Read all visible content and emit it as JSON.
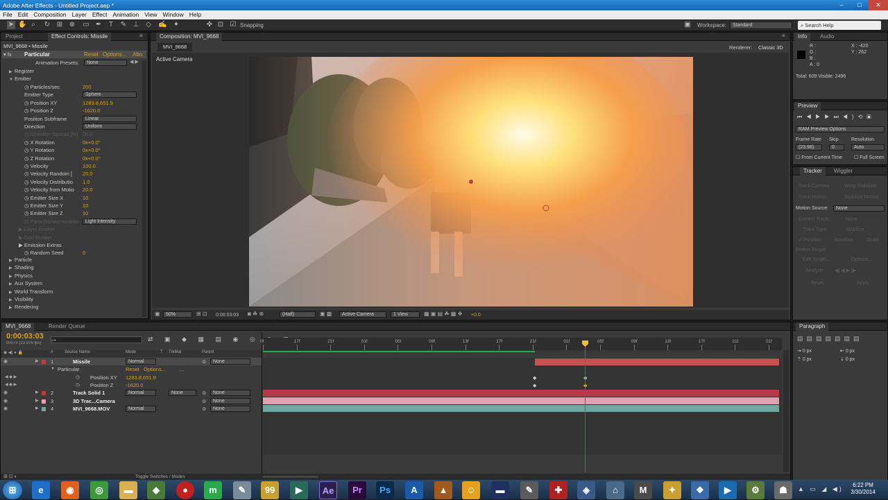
{
  "window": {
    "title": "Adobe After Effects - Untitled Project.aep *",
    "help_placeholder": "Search Help"
  },
  "menu": [
    "File",
    "Edit",
    "Composition",
    "Layer",
    "Effect",
    "Animation",
    "View",
    "Window",
    "Help"
  ],
  "toolbar": {
    "snapping": "Snapping",
    "workspace_label": "Workspace:",
    "workspace": "Standard"
  },
  "effect_panel": {
    "tabs": [
      "Project",
      "Effect Controls: Missile"
    ],
    "header": "MVI_9668 • Missile",
    "effect_name": "Particular",
    "reset": "Reset",
    "options": "Options...",
    "about": "Abo",
    "presets_label": "Animation Presets:",
    "presets_value": "None",
    "groups": [
      "Register",
      "Emitter"
    ],
    "emitter_props": [
      {
        "label": "Particles/sec",
        "value": "200"
      },
      {
        "label": "Emitter Type",
        "value": "Sphere"
      },
      {
        "label": "Position XY",
        "value": "1283.8,651.9"
      },
      {
        "label": "Position Z",
        "value": "-1620.0"
      },
      {
        "label": "Position Subframe",
        "value": "Linear"
      },
      {
        "label": "Direction",
        "value": "Uniform"
      },
      {
        "label": "Direction Spread [%]",
        "value": "20.0"
      },
      {
        "label": "X Rotation",
        "value": "0x+0.0°"
      },
      {
        "label": "Y Rotation",
        "value": "0x+0.0°"
      },
      {
        "label": "Z Rotation",
        "value": "0x+0.0°"
      },
      {
        "label": "Velocity",
        "value": "100.0"
      },
      {
        "label": "Velocity Random [",
        "value": "20.0"
      },
      {
        "label": "Velocity Distributio",
        "value": "1.0"
      },
      {
        "label": "Velocity from Motio",
        "value": "20.0"
      },
      {
        "label": "Emitter Size X",
        "value": "10"
      },
      {
        "label": "Emitter Size Y",
        "value": "10"
      },
      {
        "label": "Emitter Size Z",
        "value": "10"
      },
      {
        "label": "Particles/sec modifier",
        "value": "Light Intensity"
      },
      {
        "label": "Layer Emitter",
        "value": ""
      },
      {
        "label": "Grid Emitter",
        "value": ""
      },
      {
        "label": "Emission Extras",
        "value": ""
      },
      {
        "label": "Random Seed",
        "value": "0"
      }
    ],
    "other_groups": [
      "Particle",
      "Shading",
      "Physics",
      "Aux System",
      "World Transform",
      "Visibility",
      "Rendering"
    ]
  },
  "composition": {
    "tab": "Composition: MVI_9668",
    "subtab": "MVI_9668",
    "renderer_label": "Renderer:",
    "renderer": "Classic 3D",
    "active_camera": "Active Camera",
    "footer": {
      "zoom": "50%",
      "timecode": "0:00:03:03",
      "quality": "(Half)",
      "camera": "Active Camera",
      "views": "1 View",
      "exposure": "+0.0"
    }
  },
  "info_panel": {
    "tabs": [
      "Info",
      "Audio"
    ],
    "rgba": [
      "R :",
      "G :",
      "B :",
      "A : 0"
    ],
    "coords": [
      "X : -420",
      "Y : 262"
    ],
    "total": "Total: 609  Visible: 2496"
  },
  "preview_panel": {
    "tab": "Preview",
    "ram_options": "RAM Preview Options",
    "frame_rate_label": "Frame Rate",
    "skip_label": "Skip",
    "resolution_label": "Resolution",
    "frame_rate": "(23.98)",
    "skip": "0",
    "resolution": "Auto",
    "from_current": "From Current Time",
    "full_screen": "Full Screen"
  },
  "tracker_panel": {
    "tabs": [
      "Tracker",
      "Wiggler"
    ],
    "buttons": [
      "Track Camera",
      "Warp Stabilizer",
      "Track Motion",
      "Stabilize Motion"
    ],
    "motion_source_label": "Motion Source:",
    "motion_source": "None",
    "current_track": "Current Track:",
    "current_track_value": "None",
    "track_type": "Track Type:",
    "track_type_value": "Stabilize",
    "checks": [
      "Position",
      "Rotation",
      "Scale"
    ],
    "motion_target": "Motion Target:",
    "edit_target": "Edit Target...",
    "options": "Options...",
    "analyze": "Analyze:",
    "reset": "Reset",
    "apply": "Apply"
  },
  "timeline": {
    "tabs": [
      "MVI_9668",
      "Render Queue"
    ],
    "timecode": "0:00:03:03",
    "frame_info": "00075 (23.976 fps)",
    "columns": [
      "#",
      "Source Name",
      "Mode",
      "T",
      "TrkMat",
      "Parent"
    ],
    "ruler": [
      "0f",
      "17f",
      "21f",
      "01f",
      "05f",
      "09f",
      "13f",
      "17f",
      "21f",
      "01f",
      "05f",
      "09f",
      "13f",
      "17f",
      "21f",
      "01f"
    ],
    "layers": [
      {
        "num": "1",
        "name": "Missile",
        "mode": "Normal",
        "trkmat": "",
        "parent": "None",
        "color": "#c23a3a"
      },
      {
        "num": "2",
        "name": "Track Solid 1",
        "mode": "Normal",
        "trkmat": "None",
        "parent": "None",
        "color": "#c23a3a"
      },
      {
        "num": "3",
        "name": "3D Trac...Camera",
        "mode": "",
        "trkmat": "",
        "parent": "None",
        "color": "#e8a0b0"
      },
      {
        "num": "4",
        "name": "MVI_9668.MOV",
        "mode": "Normal",
        "trkmat": "",
        "parent": "None",
        "color": "#70a8a0"
      }
    ],
    "sub": {
      "effect": "Particular",
      "reset": "Reset",
      "options": "Options...",
      "more": "...",
      "pos_xy_label": "Position XY",
      "pos_xy": "1283.8,651.9",
      "pos_z_label": "Position Z",
      "pos_z": "-1620.0"
    },
    "toggle": "Toggle Switches / Modes"
  },
  "paragraph_panel": {
    "tab": "Paragraph",
    "fields": [
      "0 px",
      "0 px",
      "0 px",
      "0 px",
      "0 px"
    ]
  },
  "taskbar": {
    "time": "6:22 PM",
    "date": "3/30/2014",
    "apps": [
      "start-orb",
      "ie",
      "firefox",
      "chrome",
      "explorer",
      "app",
      "record",
      "tool",
      "notepad",
      "ae",
      "pr",
      "ps",
      "app2",
      "app3",
      "app4",
      "app5",
      "app6",
      "app7",
      "app8",
      "app9",
      "app10",
      "app11",
      "app12"
    ]
  }
}
